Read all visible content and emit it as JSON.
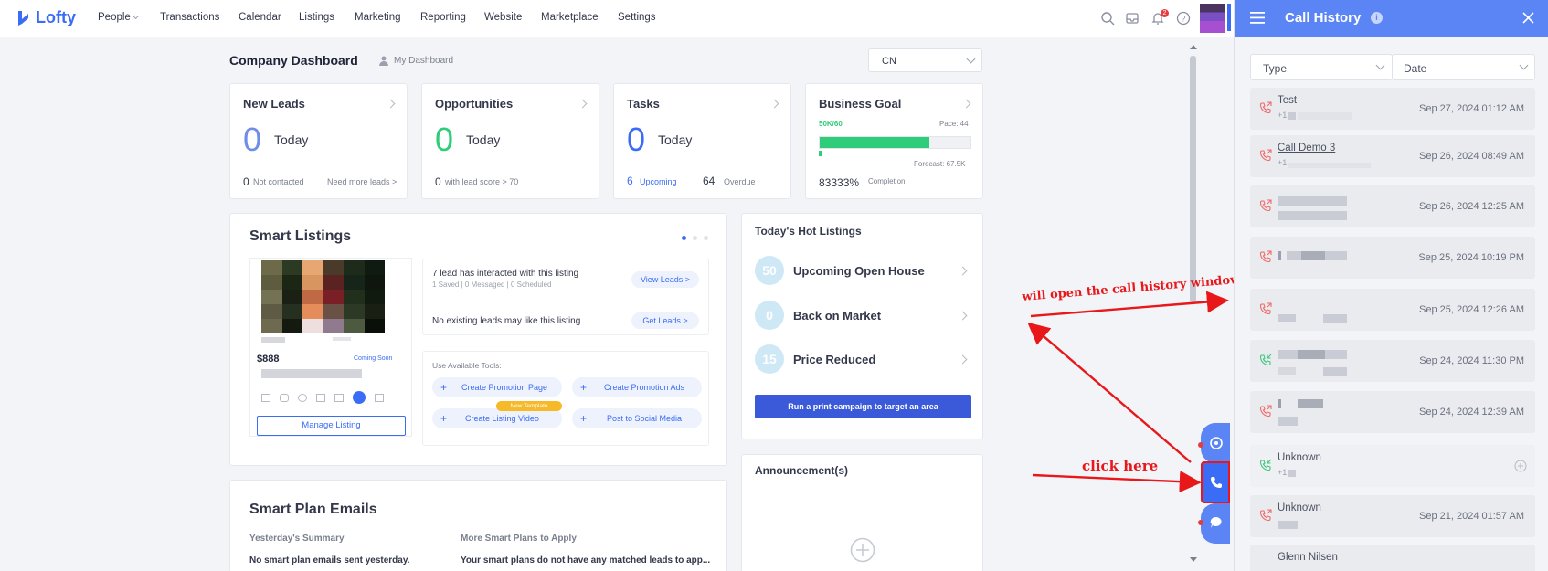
{
  "app": {
    "name": "Lofty"
  },
  "nav": {
    "items": [
      "People",
      "Transactions",
      "Calendar",
      "Listings",
      "Marketing",
      "Reporting",
      "Website",
      "Marketplace",
      "Settings"
    ],
    "notification_count": "2"
  },
  "dashboard": {
    "title": "Company Dashboard",
    "my_dashboard": "My Dashboard",
    "region_select": "CN"
  },
  "cards": {
    "new_leads": {
      "title": "New Leads",
      "count": "0",
      "today": "Today",
      "sub_count": "0",
      "sub_label": "Not contacted",
      "link": "Need more leads >"
    },
    "opportunities": {
      "title": "Opportunities",
      "count": "0",
      "today": "Today",
      "sub_count": "0",
      "sub_label": "with lead score > 70"
    },
    "tasks": {
      "title": "Tasks",
      "count": "0",
      "today": "Today",
      "upcoming_count": "6",
      "upcoming_label": "Upcoming",
      "overdue_count": "64",
      "overdue_label": "Overdue"
    },
    "business_goal": {
      "title": "Business Goal",
      "progress_text": "50K/60",
      "pace": "Pace: 44",
      "forecast": "Forecast: 67.5K",
      "completion_value": "83333%",
      "completion_label": "Completion",
      "progress_fraction": 0.73
    }
  },
  "smart_listings": {
    "title": "Smart Listings",
    "price": "$888",
    "status": "Coming Soon",
    "manage_button": "Manage Listing",
    "interaction_text": "7 lead has interacted with this listing",
    "interaction_sub": "1 Saved | 0 Messaged | 0 Scheduled",
    "view_leads": "View Leads >",
    "no_leads_text": "No existing leads may like this listing",
    "get_leads": "Get Leads >",
    "tools_label": "Use Available Tools:",
    "tools": [
      "Create Promotion Page",
      "Create Promotion Ads",
      "Create Listing Video",
      "Post to Social Media"
    ],
    "new_template_badge": "New Template"
  },
  "hot_listings": {
    "title": "Today's Hot Listings",
    "items": [
      {
        "count": "50",
        "label": "Upcoming Open House"
      },
      {
        "count": "0",
        "label": "Back on Market"
      },
      {
        "count": "15",
        "label": "Price Reduced"
      }
    ],
    "campaign_button": "Run a print campaign to target an area"
  },
  "announcements": {
    "title": "Announcement(s)"
  },
  "smart_plan": {
    "title": "Smart Plan Emails",
    "yesterday_heading": "Yesterday's Summary",
    "yesterday_text": "No smart plan emails sent yesterday.",
    "more_heading": "More Smart Plans to Apply",
    "more_text": "Your smart plans do not have any matched leads to app..."
  },
  "annotations": {
    "open_window": "will open the call history window",
    "click_here": "click here"
  },
  "call_history": {
    "title": "Call History",
    "type_filter": "Type",
    "date_filter": "Date",
    "calls": [
      {
        "name": "Test",
        "sub": "+1",
        "date": "Sep 27, 2024 01:12 AM",
        "direction": "outgoing-red"
      },
      {
        "name": "Call Demo 3",
        "sub": "+1",
        "date": "Sep 26, 2024 08:49 AM",
        "direction": "outgoing-red"
      },
      {
        "name": "",
        "sub": "",
        "date": "Sep 26, 2024 12:25 AM",
        "direction": "outgoing-red"
      },
      {
        "name": "",
        "sub": "",
        "date": "Sep 25, 2024 10:19 PM",
        "direction": "outgoing-red"
      },
      {
        "name": "",
        "sub": "",
        "date": "Sep 25, 2024 12:26 AM",
        "direction": "outgoing-red"
      },
      {
        "name": "",
        "sub": "",
        "date": "Sep 24, 2024 11:30 PM",
        "direction": "incoming-green"
      },
      {
        "name": "",
        "sub": "",
        "date": "Sep 24, 2024 12:39 AM",
        "direction": "outgoing-red"
      },
      {
        "name": "Unknown",
        "sub": "+1",
        "date": "",
        "direction": "incoming-green"
      },
      {
        "name": "Unknown",
        "sub": "",
        "date": "Sep 21, 2024 01:57 AM",
        "direction": "outgoing-red"
      },
      {
        "name": "Glenn Nilsen",
        "sub": "",
        "date": "",
        "direction": "outgoing-red"
      }
    ]
  },
  "colors": {
    "accent": "#3b6cf5",
    "panel_header": "#5b84f4",
    "green": "#2fcc7a",
    "red": "#e8171a"
  }
}
